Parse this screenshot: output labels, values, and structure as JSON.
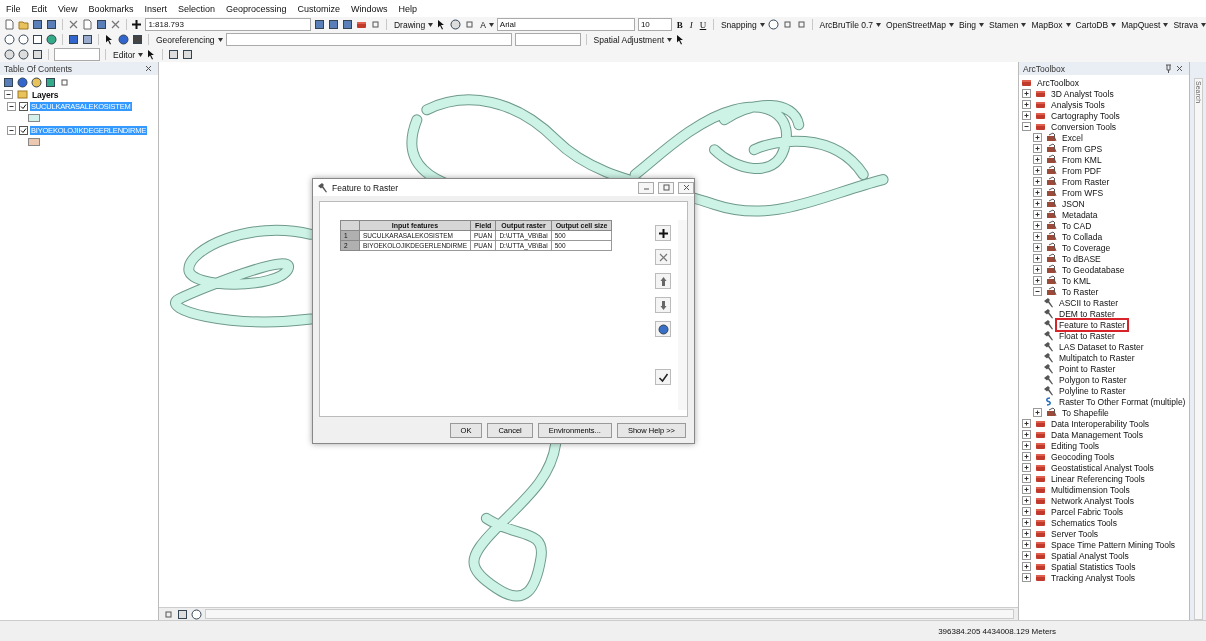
{
  "menu": [
    "File",
    "Edit",
    "View",
    "Bookmarks",
    "Insert",
    "Selection",
    "Geoprocessing",
    "Customize",
    "Windows",
    "Help"
  ],
  "toolbars": {
    "scale": "1:818.793",
    "drawing": "Drawing",
    "font": "Arial",
    "font_size": "10",
    "bold": "B",
    "italic": "I",
    "underline": "U",
    "font_color": "A",
    "snapping": "Snapping",
    "arcbrutile": "ArcBruTile 0.7",
    "basemaps": [
      "OpenStreetMap",
      "Bing",
      "Stamen",
      "MapBox",
      "CartoDB",
      "MapQuest",
      "Strava"
    ],
    "georeferencing": "Georeferencing",
    "spatial_adjustment": "Spatial Adjustment",
    "editor": "Editor"
  },
  "toc": {
    "title": "Table Of Contents",
    "root": {
      "label": "Layers",
      "expanded": true
    },
    "layers": [
      {
        "label": "SUCULKARASALEKOSISTEM",
        "checked": true,
        "selected": true,
        "color": "#d4f0ea"
      },
      {
        "label": "BIYOEKOLOJIKDEGERLENDIRME",
        "checked": true,
        "selected": true,
        "color": "#ecc8b0"
      }
    ]
  },
  "dialog": {
    "title": "Feature to Raster",
    "columns": [
      "Input features",
      "Field",
      "Output raster",
      "Output cell size"
    ],
    "rows": [
      {
        "number": "1",
        "cells": [
          "SUCULKARASALEKOSISTEM",
          "PUAN",
          "D:\\UTTA_VB\\Bai",
          "500"
        ]
      },
      {
        "number": "2",
        "cells": [
          "BIYOEKOLOJIKDEGERLENDIRME",
          "PUAN",
          "D:\\UTTA_VB\\Bai",
          "500"
        ]
      }
    ],
    "buttons": [
      "OK",
      "Cancel",
      "Environments...",
      "Show Help >>"
    ]
  },
  "toolbox": {
    "title": "ArcToolbox",
    "search_tab": "Search",
    "root": "ArcToolbox",
    "items": [
      {
        "kind": "toolbox",
        "label": "3D Analyst Tools",
        "expanded": false
      },
      {
        "kind": "toolbox",
        "label": "Analysis Tools",
        "expanded": false
      },
      {
        "kind": "toolbox",
        "label": "Cartography Tools",
        "expanded": false
      },
      {
        "kind": "toolbox",
        "label": "Conversion Tools",
        "expanded": true,
        "children": [
          {
            "kind": "toolset",
            "label": "Excel",
            "expanded": false
          },
          {
            "kind": "toolset",
            "label": "From GPS",
            "expanded": false
          },
          {
            "kind": "toolset",
            "label": "From KML",
            "expanded": false
          },
          {
            "kind": "toolset",
            "label": "From PDF",
            "expanded": false
          },
          {
            "kind": "toolset",
            "label": "From Raster",
            "expanded": false
          },
          {
            "kind": "toolset",
            "label": "From WFS",
            "expanded": false
          },
          {
            "kind": "toolset",
            "label": "JSON",
            "expanded": false
          },
          {
            "kind": "toolset",
            "label": "Metadata",
            "expanded": false
          },
          {
            "kind": "toolset",
            "label": "To CAD",
            "expanded": false
          },
          {
            "kind": "toolset",
            "label": "To Collada",
            "expanded": false
          },
          {
            "kind": "toolset",
            "label": "To Coverage",
            "expanded": false
          },
          {
            "kind": "toolset",
            "label": "To dBASE",
            "expanded": false
          },
          {
            "kind": "toolset",
            "label": "To Geodatabase",
            "expanded": false
          },
          {
            "kind": "toolset",
            "label": "To KML",
            "expanded": false
          },
          {
            "kind": "toolset",
            "label": "To Raster",
            "expanded": true,
            "children": [
              {
                "kind": "tool",
                "label": "ASCII to Raster",
                "highlighted": false
              },
              {
                "kind": "tool",
                "label": "DEM to Raster",
                "highlighted": false
              },
              {
                "kind": "tool",
                "label": "Feature to Raster",
                "highlighted": true
              },
              {
                "kind": "tool",
                "label": "Float to Raster",
                "highlighted": false
              },
              {
                "kind": "tool",
                "label": "LAS Dataset to Raster",
                "highlighted": false
              },
              {
                "kind": "tool",
                "label": "Multipatch to Raster",
                "highlighted": false
              },
              {
                "kind": "tool",
                "label": "Point to Raster",
                "highlighted": false
              },
              {
                "kind": "tool",
                "label": "Polygon to Raster",
                "highlighted": false
              },
              {
                "kind": "tool",
                "label": "Polyline to Raster",
                "highlighted": false
              },
              {
                "kind": "script",
                "label": "Raster To Other Format (multiple)",
                "highlighted": false
              }
            ]
          },
          {
            "kind": "toolset",
            "label": "To Shapefile",
            "expanded": false
          }
        ]
      },
      {
        "kind": "toolbox",
        "label": "Data Interoperability Tools",
        "expanded": false
      },
      {
        "kind": "toolbox",
        "label": "Data Management Tools",
        "expanded": false
      },
      {
        "kind": "toolbox",
        "label": "Editing Tools",
        "expanded": false
      },
      {
        "kind": "toolbox",
        "label": "Geocoding Tools",
        "expanded": false
      },
      {
        "kind": "toolbox",
        "label": "Geostatistical Analyst Tools",
        "expanded": false
      },
      {
        "kind": "toolbox",
        "label": "Linear Referencing Tools",
        "expanded": false
      },
      {
        "kind": "toolbox",
        "label": "Multidimension Tools",
        "expanded": false
      },
      {
        "kind": "toolbox",
        "label": "Network Analyst Tools",
        "expanded": false
      },
      {
        "kind": "toolbox",
        "label": "Parcel Fabric Tools",
        "expanded": false
      },
      {
        "kind": "toolbox",
        "label": "Schematics Tools",
        "expanded": false
      },
      {
        "kind": "toolbox",
        "label": "Server Tools",
        "expanded": false
      },
      {
        "kind": "toolbox",
        "label": "Space Time Pattern Mining Tools",
        "expanded": false
      },
      {
        "kind": "toolbox",
        "label": "Spatial Analyst Tools",
        "expanded": false
      },
      {
        "kind": "toolbox",
        "label": "Spatial Statistics Tools",
        "expanded": false
      },
      {
        "kind": "toolbox",
        "label": "Tracking Analyst Tools",
        "expanded": false
      }
    ]
  },
  "status": {
    "coordinates": "396384.205 4434008.129 Meters"
  }
}
